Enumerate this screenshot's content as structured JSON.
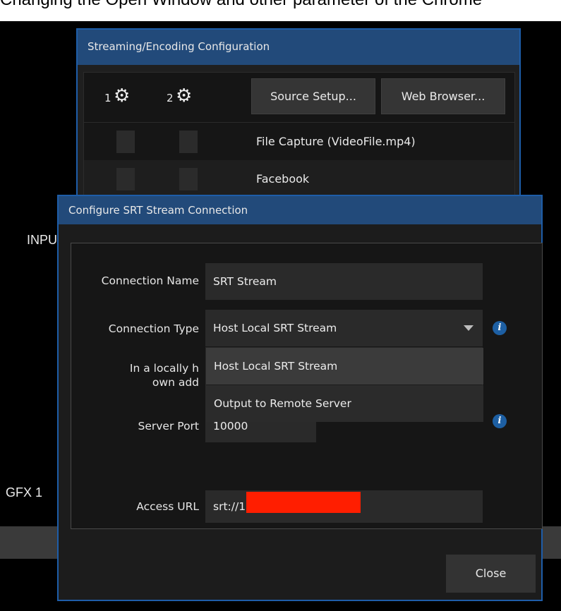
{
  "background": {
    "top_caption": "Changing the Open Window and other parameter of the Chrome",
    "inputs_label": "INPUTS",
    "gfx_label": "GFX 1"
  },
  "streaming_window": {
    "title": "Streaming/Encoding Configuration",
    "col1_number": "1",
    "col2_number": "2",
    "source_setup_button": "Source Setup...",
    "web_browser_button": "Web Browser...",
    "rows": [
      {
        "label": "File Capture (VideoFile.mp4)"
      },
      {
        "label": "Facebook"
      }
    ]
  },
  "srt_dialog": {
    "title": "Configure SRT Stream Connection",
    "connection_name_label": "Connection Name",
    "connection_name_value": "SRT Stream",
    "connection_type_label": "Connection Type",
    "connection_type_value": "Host Local SRT Stream",
    "help_text_line1": "In a locally h",
    "help_text_line2": "own add",
    "dropdown_options": [
      "Host Local SRT Stream",
      "Output to Remote Server"
    ],
    "server_port_label": "Server Port",
    "server_port_value": "10000",
    "access_url_label": "Access URL",
    "access_url_value": "srt://1",
    "close_button": "Close"
  },
  "colors": {
    "title_bar": "#224a7a",
    "window_border": "#1e5da8",
    "info_icon": "#1d5fa3",
    "redaction": "#ff1e00"
  },
  "icons": [
    "gear-icon",
    "chevron-down-icon",
    "info-icon"
  ]
}
